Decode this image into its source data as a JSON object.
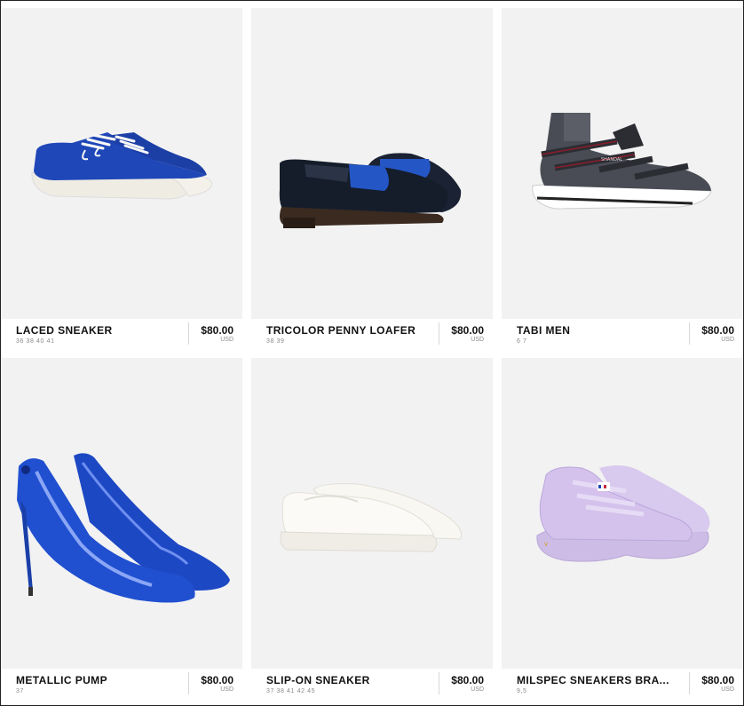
{
  "products": [
    {
      "name": "LACED SNEAKER",
      "sizes": "36 38 40 41",
      "price": "$80.00",
      "currency": "USD",
      "image_icon": "blue-sneaker-image"
    },
    {
      "name": "TRICOLOR PENNY LOAFER",
      "sizes": "38 39",
      "price": "$80.00",
      "currency": "USD",
      "image_icon": "penny-loafer-image"
    },
    {
      "name": "TABI MEN",
      "sizes": "6 7",
      "price": "$80.00",
      "currency": "USD",
      "image_icon": "tabi-sandal-image"
    },
    {
      "name": "METALLIC PUMP",
      "sizes": "37",
      "price": "$80.00",
      "currency": "USD",
      "image_icon": "metallic-pump-image"
    },
    {
      "name": "SLIP-ON SNEAKER",
      "sizes": "37 38 41 42 45",
      "price": "$80.00",
      "currency": "USD",
      "image_icon": "slip-on-sneaker-image"
    },
    {
      "name": "MILSPEC SNEAKERS BRA...",
      "sizes": "9,5",
      "price": "$80.00",
      "currency": "USD",
      "image_icon": "lilac-sneaker-image"
    }
  ],
  "colors": {
    "card_bg": "#f3f3f3",
    "blue": "#1f47b8",
    "lilac": "#cdb9e6"
  }
}
